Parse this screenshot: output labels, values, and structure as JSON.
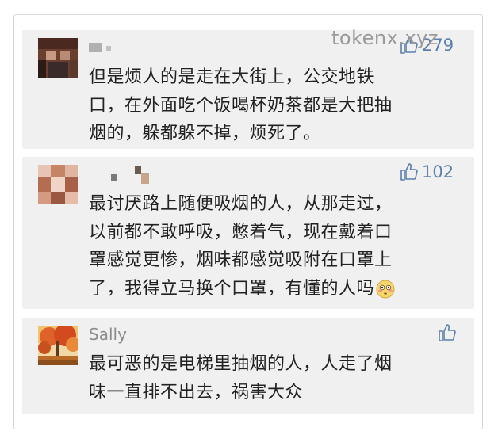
{
  "watermark": "tokenx.xyz",
  "comments": [
    {
      "name": "",
      "likes": "279",
      "text": "但是烦人的是走在大街上，公交地铁\n口，在外面吃个饭喝杯奶茶都是大把抽\n烟的，躲都躲不掉，烦死了。"
    },
    {
      "name": "",
      "likes": "102",
      "text": "最讨厌路上随便吸烟的人，从那走过，\n以前都不敢呼吸，憋着气，现在戴着口\n罩感觉更惨，烟味都感觉吸附在口罩上\n了，我得立马换个口罩，有懂的人吗",
      "emoji": "flushed-face-icon"
    },
    {
      "name": "Sally",
      "likes": "",
      "text": "最可恶的是电梯里抽烟的人，人走了烟\n味一直排不出去，祸害大众"
    }
  ],
  "colors": {
    "like_blue": "#5a7fb0",
    "text": "#222222",
    "card_bg": "#f0f0f0"
  }
}
